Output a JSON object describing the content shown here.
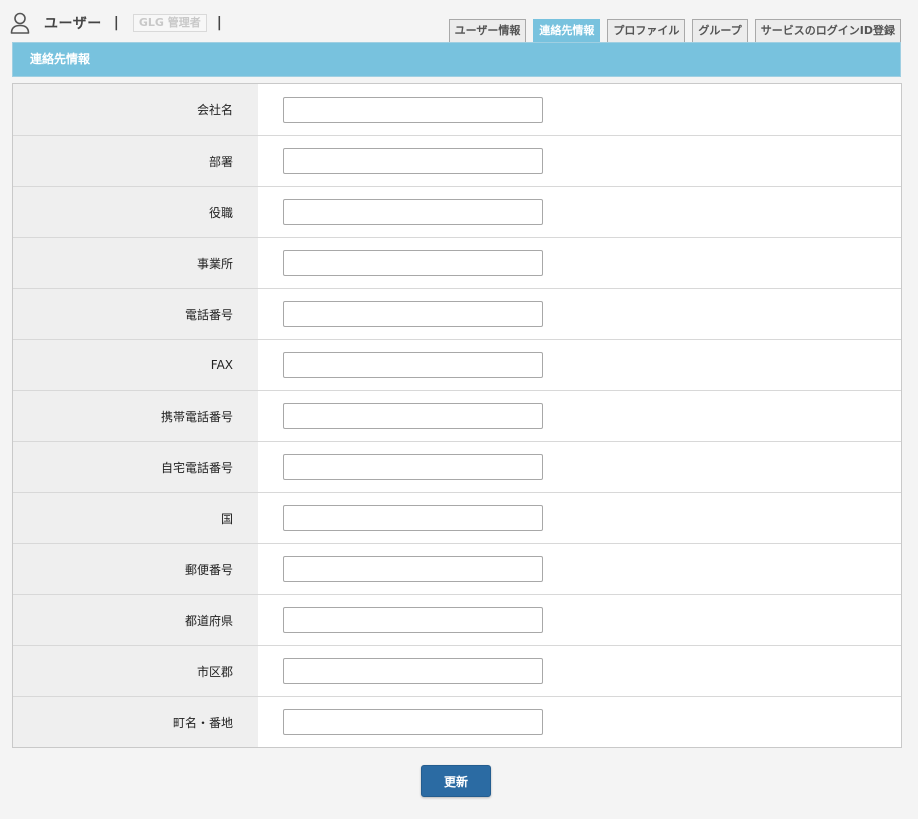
{
  "header": {
    "title": "ユーザー",
    "separator": "|",
    "org_badge": "GLG 管理者",
    "icon": "user-icon"
  },
  "tabs": [
    {
      "label": "ユーザー情報",
      "active": false
    },
    {
      "label": "連絡先情報",
      "active": true
    },
    {
      "label": "プロファイル",
      "active": false
    },
    {
      "label": "グループ",
      "active": false
    },
    {
      "label": "サービスのログインID登録",
      "active": false
    }
  ],
  "section": {
    "title": "連絡先情報"
  },
  "form": {
    "fields": [
      {
        "label": "会社名",
        "value": ""
      },
      {
        "label": "部署",
        "value": ""
      },
      {
        "label": "役職",
        "value": ""
      },
      {
        "label": "事業所",
        "value": ""
      },
      {
        "label": "電話番号",
        "value": ""
      },
      {
        "label": "FAX",
        "value": ""
      },
      {
        "label": "携帯電話番号",
        "value": ""
      },
      {
        "label": "自宅電話番号",
        "value": ""
      },
      {
        "label": "国",
        "value": ""
      },
      {
        "label": "郵便番号",
        "value": ""
      },
      {
        "label": "都道府県",
        "value": ""
      },
      {
        "label": "市区郡",
        "value": ""
      },
      {
        "label": "町名・番地",
        "value": ""
      }
    ]
  },
  "actions": {
    "submit_label": "更新"
  },
  "colors": {
    "accent": "#78c2de",
    "button": "#2b6ba3",
    "label_bg": "#efefef",
    "page_bg": "#f4f4f4"
  }
}
